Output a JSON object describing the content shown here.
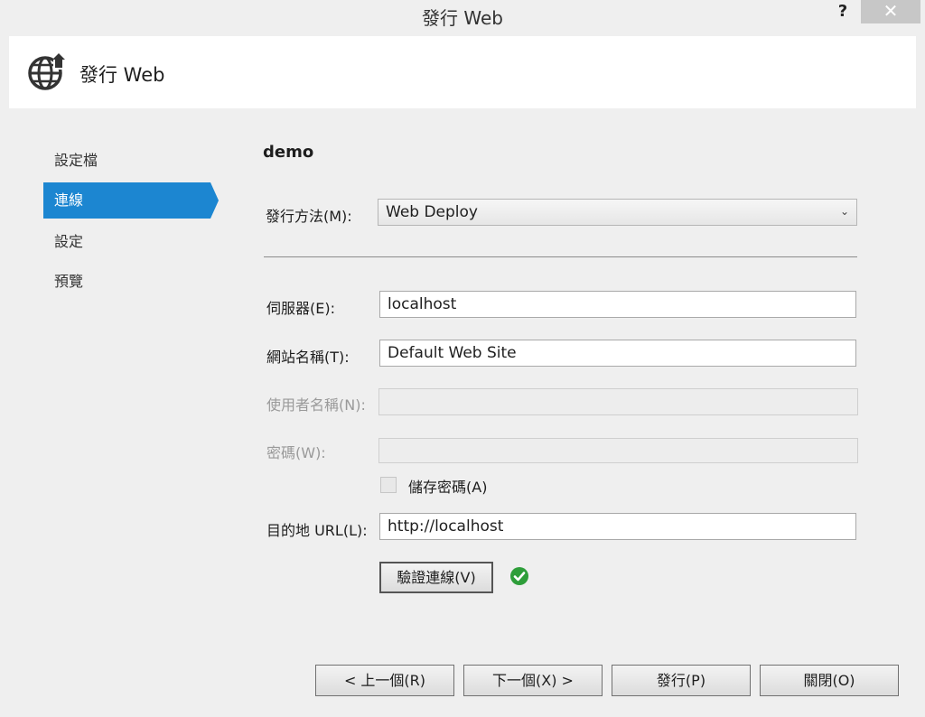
{
  "window": {
    "title": "發行 Web",
    "help_label": "?",
    "close_label": "✕"
  },
  "header": {
    "title": "發行 Web",
    "icon": "globe-publish-icon"
  },
  "sidebar": {
    "items": [
      {
        "label": "設定檔"
      },
      {
        "label": "連線"
      },
      {
        "label": "設定"
      },
      {
        "label": "預覽"
      }
    ]
  },
  "main": {
    "profile_name": "demo",
    "publish_method": {
      "label": "發行方法(M):",
      "value": "Web Deploy"
    },
    "server": {
      "label": "伺服器(E):",
      "value": "localhost"
    },
    "site_name": {
      "label": "網站名稱(T):",
      "value": "Default Web Site"
    },
    "username": {
      "label": "使用者名稱(N):",
      "value": ""
    },
    "password": {
      "label": "密碼(W):",
      "value": ""
    },
    "save_password": {
      "label": "儲存密碼(A)"
    },
    "destination_url": {
      "label": "目的地 URL(L):",
      "value": "http://localhost"
    },
    "validate_button": {
      "label": "驗證連線(V)"
    },
    "validation_status_icon": "check-success-icon"
  },
  "footer": {
    "prev_label": "< 上一個(R)",
    "next_label": "下一個(X) >",
    "publish_label": "發行(P)",
    "close_label": "關閉(O)"
  },
  "colors": {
    "accent": "#1c86d1",
    "success": "#2e9e3a",
    "background": "#efefef"
  }
}
